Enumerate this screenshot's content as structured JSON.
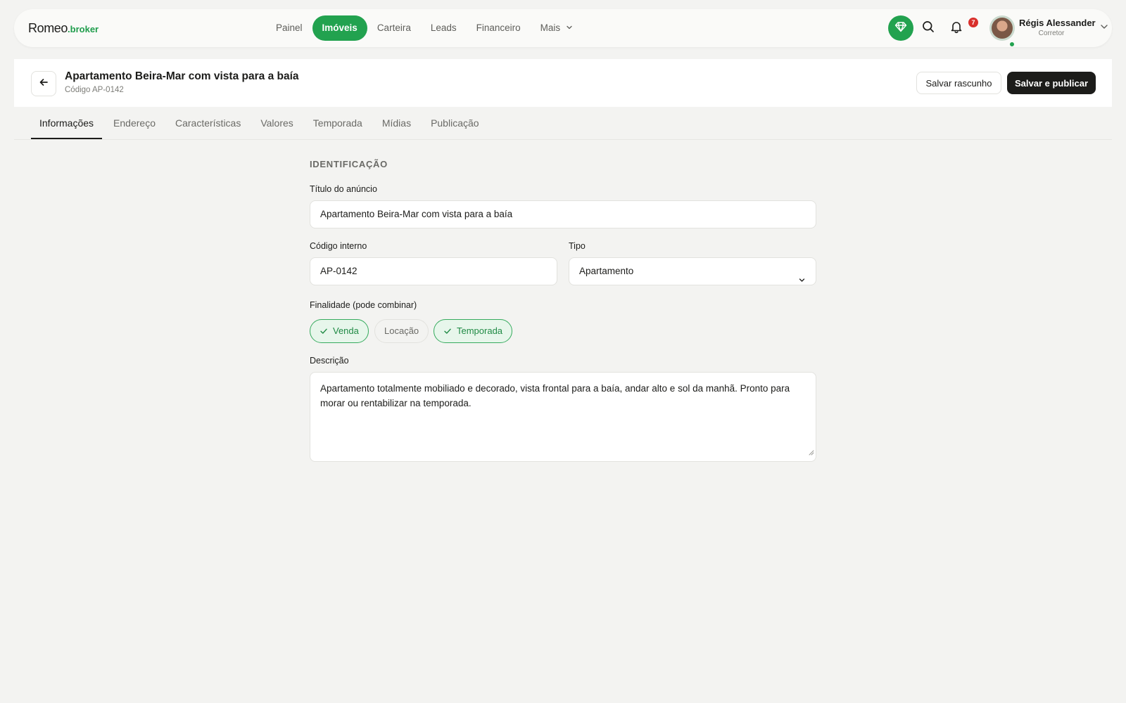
{
  "brand": {
    "name": "Romeo",
    "suffix": ".broker",
    "accent": "#22a24f"
  },
  "nav": {
    "items": [
      {
        "label": "Painel",
        "active": false
      },
      {
        "label": "Imóveis",
        "active": true
      },
      {
        "label": "Carteira",
        "active": false
      },
      {
        "label": "Leads",
        "active": false
      },
      {
        "label": "Financeiro",
        "active": false
      }
    ],
    "more_label": "Mais",
    "notifications_count": "7",
    "user": {
      "name": "Régis Alessander",
      "role": "Corretor",
      "status_color": "#22a24f"
    },
    "icons": [
      "gem-icon",
      "search-icon",
      "bell-icon",
      "chevron-down-icon"
    ]
  },
  "header": {
    "title": "Apartamento Beira-Mar com vista para a baía",
    "subtitle": "Código AP-0142",
    "draft_label": "Salvar rascunho",
    "publish_label": "Salvar e publicar"
  },
  "tabs": [
    {
      "label": "Informações",
      "active": true
    },
    {
      "label": "Endereço",
      "active": false
    },
    {
      "label": "Características",
      "active": false
    },
    {
      "label": "Valores",
      "active": false
    },
    {
      "label": "Temporada",
      "active": false
    },
    {
      "label": "Mídias",
      "active": false
    },
    {
      "label": "Publicação",
      "active": false
    }
  ],
  "form": {
    "section_title": "IDENTIFICAÇÃO",
    "title_label": "Título do anúncio",
    "title_value": "Apartamento Beira-Mar com vista para a baía",
    "code_label": "Código interno",
    "code_value": "AP-0142",
    "type_label": "Tipo",
    "type_value": "Apartamento",
    "purpose_label": "Finalidade (pode combinar)",
    "purposes": [
      {
        "label": "Venda",
        "selected": true
      },
      {
        "label": "Locação",
        "selected": false
      },
      {
        "label": "Temporada",
        "selected": true
      }
    ],
    "description_label": "Descrição",
    "description_value": "Apartamento totalmente mobiliado e decorado, vista frontal para a baía, andar alto e sol da manhã. Pronto para morar ou rentabilizar na temporada."
  }
}
